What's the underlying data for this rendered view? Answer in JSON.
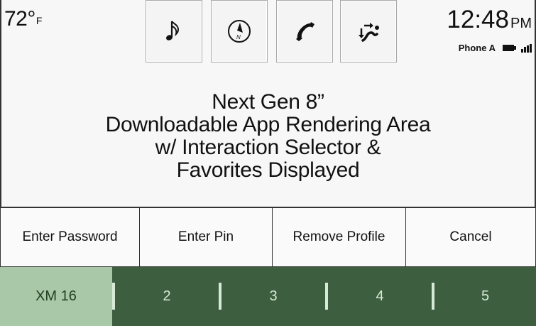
{
  "status": {
    "temperature": "72°",
    "temperature_unit": "F",
    "time": "12:48",
    "ampm": "PM",
    "phone": "Phone A"
  },
  "top_icons": [
    {
      "name": "music-note-icon"
    },
    {
      "name": "navigation-compass-icon"
    },
    {
      "name": "phone-icon"
    },
    {
      "name": "connections-icon"
    }
  ],
  "app_area": {
    "lines": [
      "Next Gen 8”",
      "Downloadable App Rendering Area",
      "w/ Interaction Selector &",
      "Favorites Displayed"
    ]
  },
  "actions": {
    "enter_password": "Enter Password",
    "enter_pin": "Enter Pin",
    "remove_profile": "Remove Profile",
    "cancel": "Cancel"
  },
  "presets": {
    "p1": "XM 16",
    "p2": "2",
    "p3": "3",
    "p4": "4",
    "p5": "5",
    "active": "XM 16"
  },
  "colors": {
    "preset_bar": "#3d5e3f",
    "preset_active": "#a9c8a8"
  }
}
